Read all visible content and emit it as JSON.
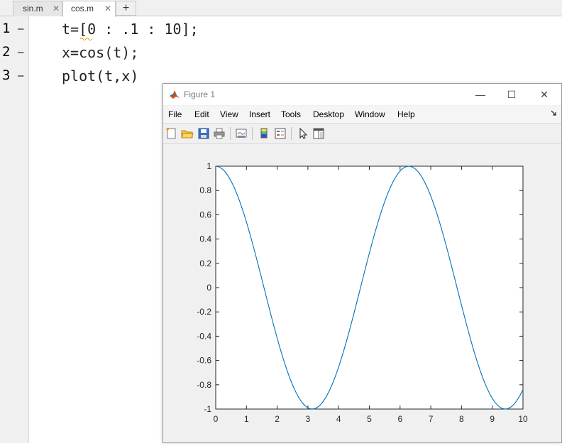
{
  "editor": {
    "tabs": [
      {
        "label": "sin.m",
        "active": false
      },
      {
        "label": "cos.m",
        "active": true
      }
    ],
    "new_tab_label": "+",
    "close_glyph": "✕",
    "lines": [
      {
        "number": "1",
        "marker": "—",
        "code": "t=[0 : .1 : 10];"
      },
      {
        "number": "2",
        "marker": "—",
        "code": "x=cos(t);"
      },
      {
        "number": "3",
        "marker": "—",
        "code": "plot(t,x)"
      }
    ]
  },
  "figure": {
    "title": "Figure 1",
    "window_buttons": {
      "minimize": "—",
      "maximize": "☐",
      "close": "✕"
    },
    "menu": [
      "File",
      "Edit",
      "View",
      "Insert",
      "Tools",
      "Desktop",
      "Window",
      "Help"
    ],
    "toolbar_icons": [
      "new-figure-icon",
      "open-file-icon",
      "save-icon",
      "print-icon",
      "link-plot-icon",
      "insert-colorbar-icon",
      "insert-legend-icon",
      "edit-plot-icon",
      "open-property-inspector-icon"
    ],
    "colors": {
      "line": "#0072bd",
      "axes": "#262626",
      "background": "#f0f0f0"
    }
  },
  "chart_data": {
    "type": "line",
    "title": "",
    "xlabel": "",
    "ylabel": "",
    "xlim": [
      0,
      10
    ],
    "ylim": [
      -1,
      1
    ],
    "xticks": [
      0,
      1,
      2,
      3,
      4,
      5,
      6,
      7,
      8,
      9,
      10
    ],
    "xtick_labels": [
      "0",
      "1",
      "2",
      "3",
      "4",
      "5",
      "6",
      "7",
      "8",
      "9",
      "10"
    ],
    "yticks": [
      -1,
      -0.8,
      -0.6,
      -0.4,
      -0.2,
      0,
      0.2,
      0.4,
      0.6,
      0.8,
      1
    ],
    "ytick_labels": [
      "-1",
      "-0.8",
      "-0.6",
      "-0.4",
      "-0.2",
      "0",
      "0.2",
      "0.4",
      "0.6",
      "0.8",
      "1"
    ],
    "grid": false,
    "series": [
      {
        "x": [
          0,
          0.1,
          0.2,
          0.3,
          0.4,
          0.5,
          0.6,
          0.7,
          0.8,
          0.9,
          1,
          1.1,
          1.2,
          1.3,
          1.4,
          1.5,
          1.6,
          1.7,
          1.8,
          1.9,
          2,
          2.1,
          2.2,
          2.3,
          2.4,
          2.5,
          2.6,
          2.7,
          2.8,
          2.9,
          3,
          3.1,
          3.2,
          3.3,
          3.4,
          3.5,
          3.6,
          3.7,
          3.8,
          3.9,
          4,
          4.1,
          4.2,
          4.3,
          4.4,
          4.5,
          4.6,
          4.7,
          4.8,
          4.9,
          5,
          5.1,
          5.2,
          5.3,
          5.4,
          5.5,
          5.6,
          5.7,
          5.8,
          5.9,
          6,
          6.1,
          6.2,
          6.3,
          6.4,
          6.5,
          6.6,
          6.7,
          6.8,
          6.9,
          7,
          7.1,
          7.2,
          7.3,
          7.4,
          7.5,
          7.6,
          7.7,
          7.8,
          7.9,
          8,
          8.1,
          8.2,
          8.3,
          8.4,
          8.5,
          8.6,
          8.7,
          8.8,
          8.9,
          9,
          9.1,
          9.2,
          9.3,
          9.4,
          9.5,
          9.6,
          9.7,
          9.8,
          9.9,
          10
        ],
        "y": [
          1.0,
          0.995,
          0.98,
          0.9553,
          0.9211,
          0.8776,
          0.8253,
          0.7648,
          0.6967,
          0.6216,
          0.5403,
          0.4536,
          0.3624,
          0.2675,
          0.17,
          0.0707,
          -0.0292,
          -0.1288,
          -0.2272,
          -0.3233,
          -0.4161,
          -0.5048,
          -0.5885,
          -0.6663,
          -0.7374,
          -0.8011,
          -0.8569,
          -0.9041,
          -0.9422,
          -0.971,
          -0.99,
          -0.9991,
          -0.9983,
          -0.9875,
          -0.9668,
          -0.9365,
          -0.8968,
          -0.8481,
          -0.791,
          -0.7259,
          -0.6536,
          -0.5748,
          -0.4903,
          -0.4008,
          -0.3073,
          -0.2108,
          -0.1122,
          -0.0124,
          0.0875,
          0.1865,
          0.2837,
          0.378,
          0.4685,
          0.5544,
          0.6347,
          0.7087,
          0.7756,
          0.8347,
          0.8855,
          0.9275,
          0.9602,
          0.9833,
          0.9965,
          0.9999,
          0.9932,
          0.9766,
          0.9502,
          0.9144,
          0.8694,
          0.8157,
          0.7539,
          0.6845,
          0.6084,
          0.5261,
          0.4385,
          0.3466,
          0.2513,
          0.1534,
          0.054,
          -0.046,
          -0.1455,
          -0.2435,
          -0.3392,
          -0.4314,
          -0.5193,
          -0.602,
          -0.6787,
          -0.7486,
          -0.8111,
          -0.8654,
          -0.9111,
          -0.9477,
          -0.9748,
          -0.9922,
          -0.9997,
          -0.9972,
          -0.9847,
          -0.9624,
          -0.9304,
          -0.8892,
          -0.8391
        ]
      }
    ]
  }
}
